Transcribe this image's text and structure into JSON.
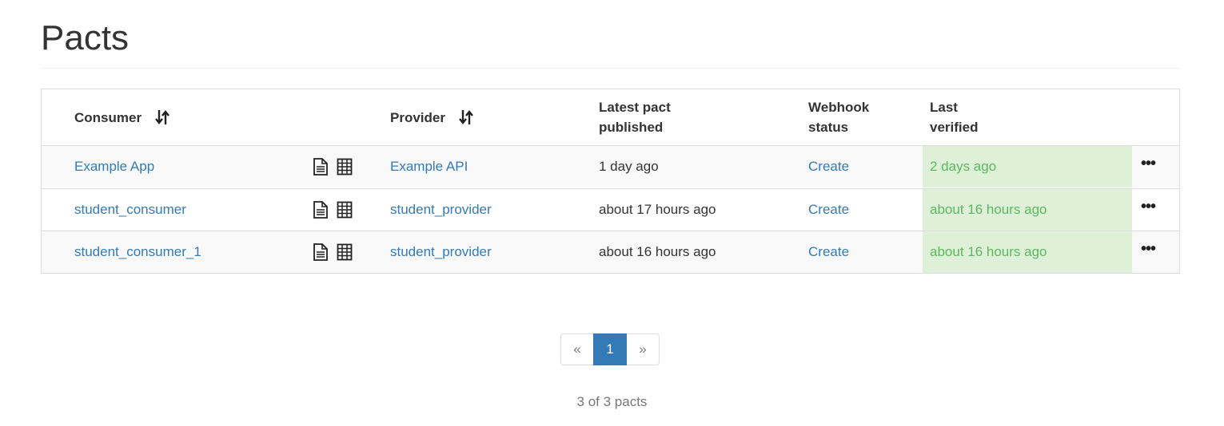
{
  "page": {
    "title": "Pacts"
  },
  "table": {
    "headers": {
      "consumer": "Consumer",
      "provider": "Provider",
      "latest_pact_line1": "Latest pact",
      "latest_pact_line2": "published",
      "webhook_line1": "Webhook",
      "webhook_line2": "status",
      "last_verified_line1": "Last",
      "last_verified_line2": "verified"
    },
    "rows": [
      {
        "consumer": "Example App",
        "provider": "Example API",
        "published": "1 day ago",
        "webhook": "Create",
        "verified": "2 days ago"
      },
      {
        "consumer": "student_consumer",
        "provider": "student_provider",
        "published": "about 17 hours ago",
        "webhook": "Create",
        "verified": "about 16 hours ago"
      },
      {
        "consumer": "student_consumer_1",
        "provider": "student_provider",
        "published": "about 16 hours ago",
        "webhook": "Create",
        "verified": "about 16 hours ago"
      }
    ],
    "icons": {
      "sort": "sort-icon",
      "document": "document-icon",
      "matrix": "matrix-grid-icon",
      "menu": "ellipsis-menu-icon"
    },
    "colors": {
      "link": "#337ab7",
      "verified_text": "#5cb85c",
      "verified_bg": "#dff0d8"
    }
  },
  "pagination": {
    "prev": "«",
    "current": "1",
    "next": "»",
    "summary": "3 of 3 pacts"
  }
}
